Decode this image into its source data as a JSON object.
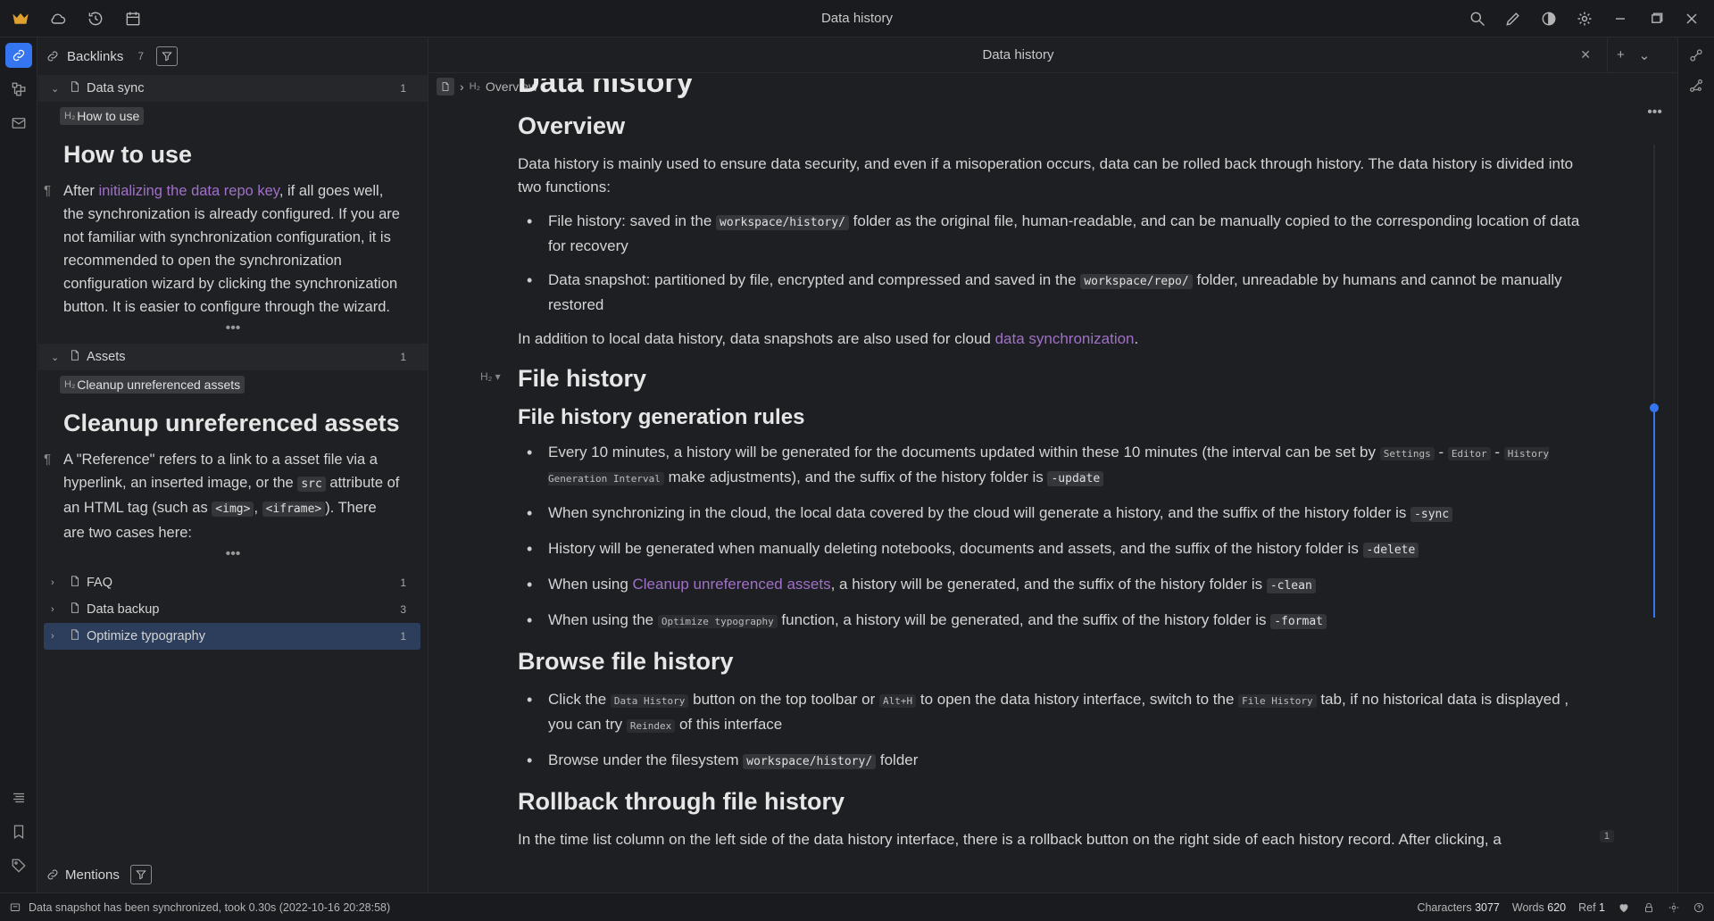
{
  "window": {
    "title": "Data history"
  },
  "backlinks": {
    "label": "Backlinks",
    "count": "7",
    "groups": [
      {
        "name": "Data sync",
        "count": "1",
        "chip": "How to use",
        "heading": "How to use",
        "para_1": "After ",
        "para_link": "initializing the data repo key",
        "para_2": ", if all goes well, the synchronization is already configured. If you are not familiar with synchronization configuration, it is recommended to open the synchronization configuration wizard by clicking the synchronization button. It is easier to configure through the wizard."
      },
      {
        "name": "Assets",
        "count": "1",
        "chip": "Cleanup unreferenced assets",
        "heading": "Cleanup unreferenced assets",
        "para_1": "A \"Reference\" refers to a link to a asset file via a hyperlink, an inserted image, or the ",
        "code_1": "src",
        "para_2": " attribute of an HTML tag (such as ",
        "code_2": "<img>",
        "para_3": ", ",
        "code_3": "<iframe>",
        "para_4": "). There are two cases here:"
      }
    ],
    "collapsed": [
      {
        "name": "FAQ",
        "count": "1"
      },
      {
        "name": "Data backup",
        "count": "3"
      },
      {
        "name": "Optimize typography",
        "count": "1"
      }
    ],
    "ellipsis": "•••"
  },
  "mentions": {
    "label": "Mentions"
  },
  "tab": {
    "title": "Data history"
  },
  "breadcrumb": {
    "h_label": "H₂",
    "item": "Overview"
  },
  "doc": {
    "cut_title": "Data history",
    "overview": {
      "heading": "Overview",
      "intro": "Data history is mainly used to ensure data security, and even if a misoperation occurs, data can be rolled back through history. The data history is divided into two functions:",
      "li1_a": "File history: saved in the ",
      "li1_code": "workspace/history/",
      "li1_b": " folder as the original file, human-readable, and can be manually copied to the corresponding location of data for recovery",
      "li2_a": "Data snapshot: partitioned by file, encrypted and compressed and saved in the ",
      "li2_code": "workspace/repo/",
      "li2_b": " folder, unreadable by humans and cannot be manually restored",
      "outro_a": "In addition to local data history, data snapshots are also used for cloud ",
      "outro_link": "data synchronization",
      "outro_b": "."
    },
    "file_history": {
      "h_mark": "H₂",
      "heading": "File history",
      "rules_heading": "File history generation rules",
      "r1_a": "Every 10 minutes, a history will be generated for the documents updated within these 10 minutes (the interval can be set by ",
      "r1_k1": "Settings",
      "r1_sep1": " - ",
      "r1_k2": "Editor",
      "r1_sep2": " - ",
      "r1_k3": "History Generation Interval",
      "r1_b": " make adjustments), and the suffix of the history folder is ",
      "r1_code": "-update",
      "r2_a": "When synchronizing in the cloud, the local data covered by the cloud will generate a history, and the suffix of the history folder is ",
      "r2_code": "-sync",
      "r3_a": "History will be generated when manually deleting notebooks, documents and assets, and the suffix of the history folder is ",
      "r3_code": "-delete",
      "r4_a": "When using ",
      "r4_link": "Cleanup unreferenced assets",
      "r4_b": ", a history will be generated, and the suffix of the history folder is ",
      "r4_code": "-clean",
      "r5_a": "When using the ",
      "r5_k": "Optimize typography",
      "r5_b": " function, a history will be generated, and the suffix of the history folder is ",
      "r5_code": "-format"
    },
    "browse": {
      "heading": "Browse file history",
      "b1_a": "Click the ",
      "b1_k1": "Data History",
      "b1_b": " button on the top toolbar or ",
      "b1_k2": "Alt+H",
      "b1_c": " to open the data history interface, switch to the ",
      "b1_k3": "File History",
      "b1_d": " tab, if no historical data is displayed , you can try ",
      "b1_k4": "Reindex",
      "b1_e": " of this interface",
      "b2_a": "Browse under the filesystem ",
      "b2_code": "workspace/history/",
      "b2_b": " folder"
    },
    "rollback": {
      "heading": "Rollback through file history",
      "ref_count": "1",
      "para": "In the time list column on the left side of the data history interface, there is a rollback button on the right side of each history record. After clicking, a"
    }
  },
  "status": {
    "message": "Data snapshot has been synchronized, took 0.30s (2022-10-16 20:28:58)",
    "chars_label": "Characters",
    "chars": "3077",
    "words_label": "Words",
    "words": "620",
    "ref_label": "Ref",
    "ref": "1"
  },
  "colors": {
    "accent": "#3575f0",
    "link": "#a070c8",
    "background": "#1e1f22"
  }
}
